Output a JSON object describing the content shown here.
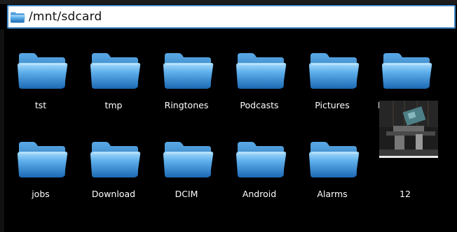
{
  "path_bar": {
    "path": "/mnt/sdcard",
    "icon": "folder-icon"
  },
  "colors": {
    "background": "#000000",
    "path_border": "#3f86c6",
    "folder_light": "#7fc6f5",
    "folder_dark": "#1f6fb8"
  },
  "items": [
    {
      "name": "tst",
      "type": "folder"
    },
    {
      "name": "tmp",
      "type": "folder"
    },
    {
      "name": "Ringtones",
      "type": "folder"
    },
    {
      "name": "Podcasts",
      "type": "folder"
    },
    {
      "name": "Pictures",
      "type": "folder"
    },
    {
      "name": "Notifications",
      "type": "folder"
    },
    {
      "name": "jobs",
      "type": "folder"
    },
    {
      "name": "Download",
      "type": "folder"
    },
    {
      "name": "DCIM",
      "type": "folder"
    },
    {
      "name": "Android",
      "type": "folder"
    },
    {
      "name": "Alarms",
      "type": "folder"
    },
    {
      "name": "12",
      "type": "image"
    }
  ]
}
